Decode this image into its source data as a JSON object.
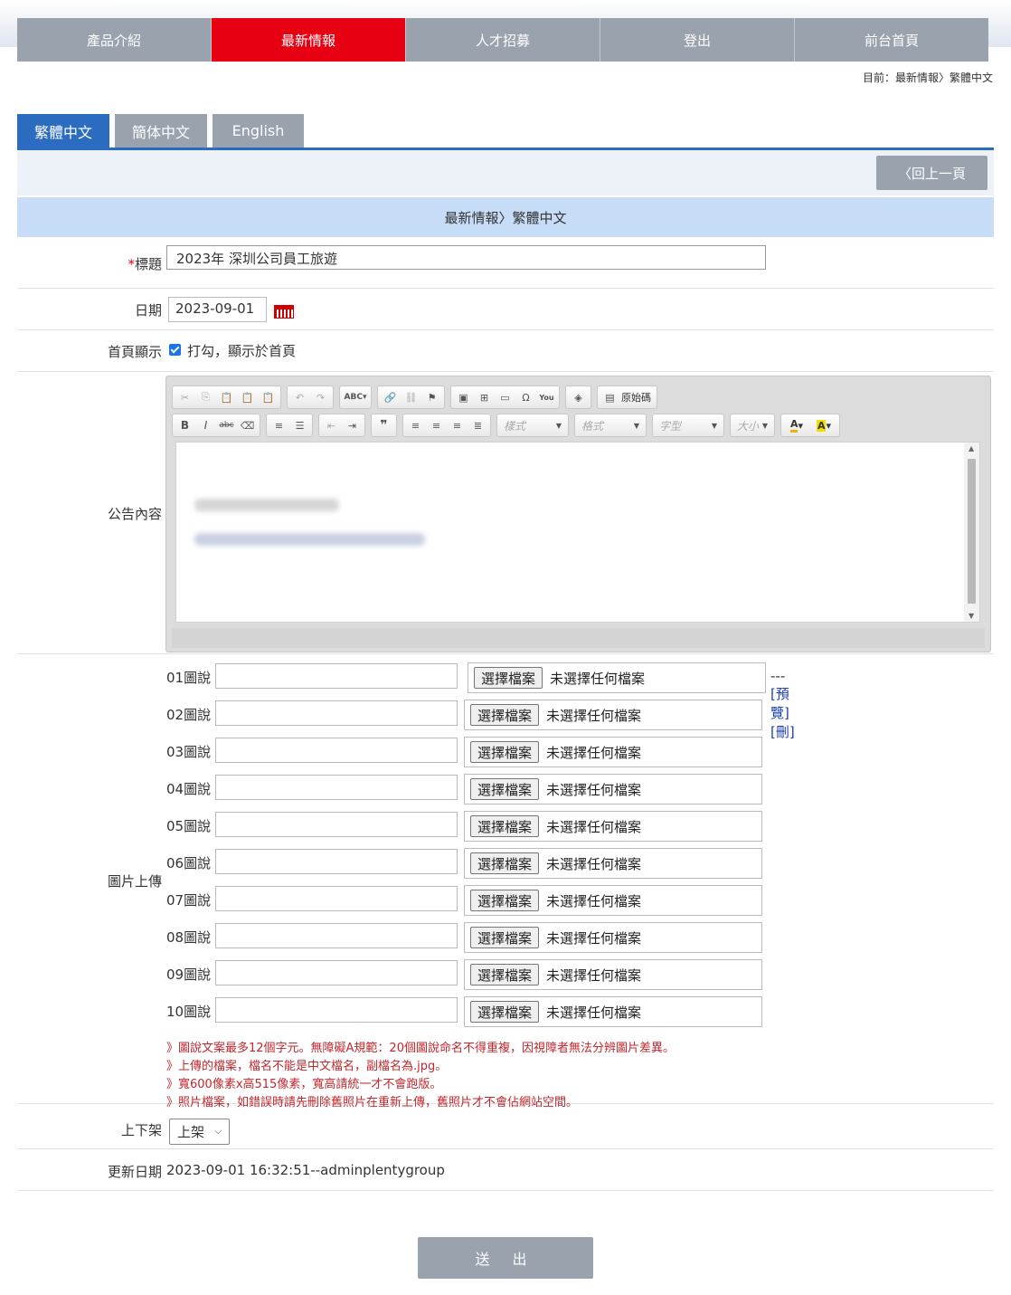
{
  "nav": {
    "items": [
      {
        "label": "產品介紹"
      },
      {
        "label": "最新情報"
      },
      {
        "label": "人才招募"
      },
      {
        "label": "登出"
      },
      {
        "label": "前台首頁"
      }
    ],
    "active_index": 1
  },
  "breadcrumb": "目前：最新情報〉繁體中文",
  "lang_tabs": [
    {
      "label": "繁體中文"
    },
    {
      "label": "簡体中文"
    },
    {
      "label": "English"
    }
  ],
  "back_button": "〈回上一頁",
  "section_title": "最新情報〉繁體中文",
  "form": {
    "title": {
      "required_mark": "*",
      "label": "標題",
      "value": "2023年 深圳公司員工旅遊"
    },
    "date": {
      "label": "日期",
      "value": "2023-09-01"
    },
    "homepage": {
      "label": "首頁顯示",
      "checked": true,
      "text": "打勾，顯示於首頁"
    },
    "content": {
      "label": "公告內容"
    },
    "images": {
      "label": "圖片上傳",
      "rows": [
        {
          "label": "01圖說",
          "caption": "",
          "button": "選擇檔案",
          "file_text": "未選擇任何檔案"
        },
        {
          "label": "02圖說",
          "caption": "",
          "button": "選擇檔案",
          "file_text": "未選擇任何檔案"
        },
        {
          "label": "03圖說",
          "caption": "",
          "button": "選擇檔案",
          "file_text": "未選擇任何檔案"
        },
        {
          "label": "04圖說",
          "caption": "",
          "button": "選擇檔案",
          "file_text": "未選擇任何檔案"
        },
        {
          "label": "05圖說",
          "caption": "",
          "button": "選擇檔案",
          "file_text": "未選擇任何檔案"
        },
        {
          "label": "06圖說",
          "caption": "",
          "button": "選擇檔案",
          "file_text": "未選擇任何檔案"
        },
        {
          "label": "07圖說",
          "caption": "",
          "button": "選擇檔案",
          "file_text": "未選擇任何檔案"
        },
        {
          "label": "08圖說",
          "caption": "",
          "button": "選擇檔案",
          "file_text": "未選擇任何檔案"
        },
        {
          "label": "09圖說",
          "caption": "",
          "button": "選擇檔案",
          "file_text": "未選擇任何檔案"
        },
        {
          "label": "10圖說",
          "caption": "",
          "button": "選擇檔案",
          "file_text": "未選擇任何檔案"
        }
      ],
      "first_row_actions": {
        "prefix": "---",
        "preview": "[預覽]",
        "delete": "[刪]"
      },
      "notes": [
        "》圖說文案最多12個字元。無障礙A規範：20個圖說命名不得重複，因視障者無法分辨圖片差異。",
        "》上傳的檔案，檔名不能是中文檔名，副檔名為.jpg。",
        "》寬600像素x高515像素，寬高請統一才不會跑版。",
        "》照片檔案，如錯誤時請先刪除舊照片在重新上傳，舊照片才不會佔網站空間。"
      ]
    },
    "status": {
      "label": "上下架",
      "value": "上架"
    },
    "updated": {
      "label": "更新日期",
      "value": "2023-09-01 16:32:51--adminplentygroup"
    }
  },
  "editor": {
    "source_button": "原始碼",
    "combos": [
      "樣式",
      "格式",
      "字型",
      "大小"
    ],
    "toolbar_icons_row1": [
      "cut-icon",
      "copy-icon",
      "paste-icon",
      "paste-text-icon",
      "paste-word-icon",
      "undo-icon",
      "redo-icon",
      "spellcheck-icon",
      "link-icon",
      "unlink-icon",
      "anchor-icon",
      "image-icon",
      "table-icon",
      "horizontal-rule-icon",
      "special-char-icon",
      "youtube-icon",
      "maximize-icon",
      "source-icon"
    ],
    "toolbar_icons_row2": [
      "bold-icon",
      "italic-icon",
      "strike-icon",
      "remove-format-icon",
      "numbered-list-icon",
      "bulleted-list-icon",
      "outdent-icon",
      "indent-icon",
      "blockquote-icon",
      "align-left-icon",
      "align-center-icon",
      "align-right-icon",
      "justify-icon",
      "text-color-icon",
      "bg-color-icon"
    ]
  },
  "submit_button": "送 出",
  "colors": {
    "accent_red": "#e60012",
    "tab_blue": "#2b6cc0",
    "gray_button": "#9aa2ad",
    "note_red": "#c1272d",
    "section_blue": "#c7dcf7"
  }
}
